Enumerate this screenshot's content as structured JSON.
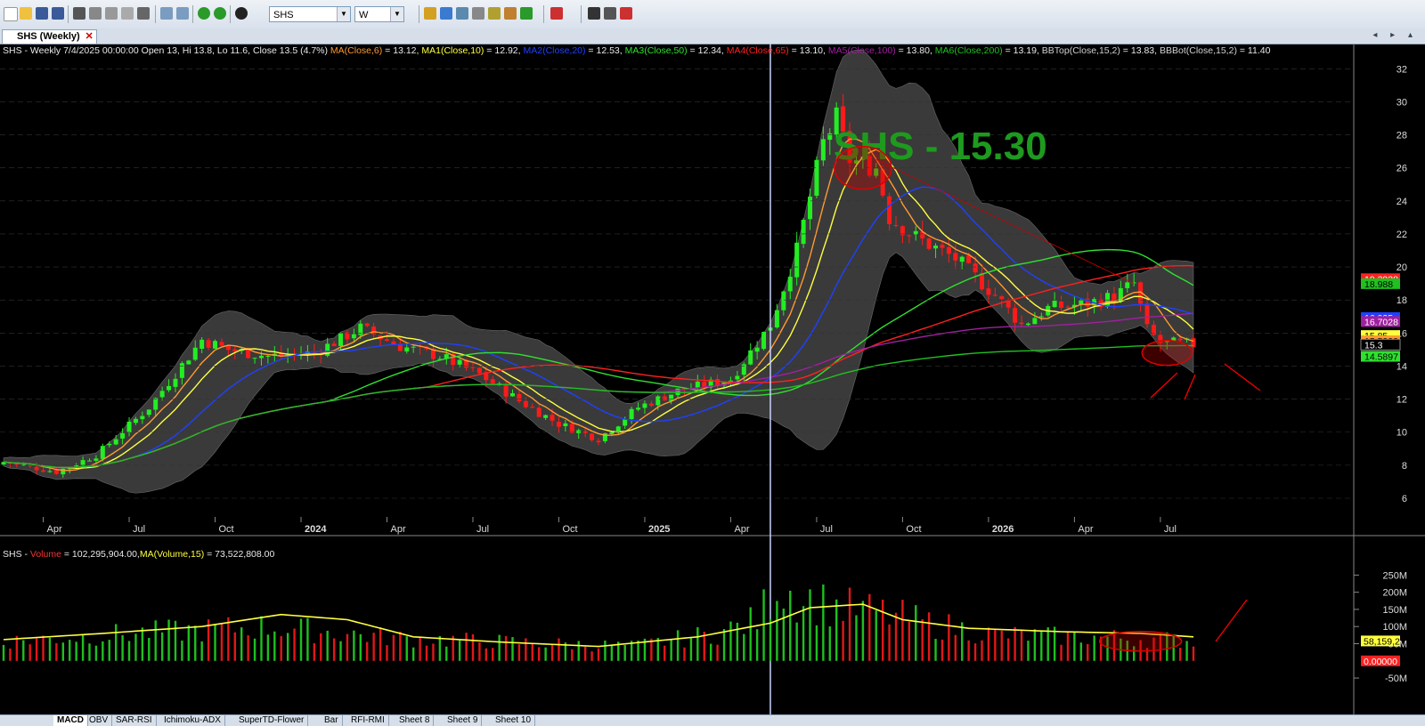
{
  "toolbar": {
    "symbol": "SHS",
    "interval": "W",
    "colors": {
      "new": "#ffffff",
      "open": "#f0c040",
      "save": "#3a5a9a",
      "print": "#555555",
      "back": "#2a9a2a",
      "forward": "#2a9a2a",
      "info": "#222222",
      "draw": "#cc3030"
    }
  },
  "window_tab": {
    "title": "SHS (Weekly)",
    "close": "✕"
  },
  "price_header": {
    "symbol_line": "SHS - Weekly 7/4/2025 00:00:00 Open 13, Hi 13.8, Lo 11.6, Close 13.5 (4.7%)",
    "indicators": [
      {
        "label": "MA(Close,6)",
        "value": " = 13.12,",
        "color": "#ff9a30"
      },
      {
        "label": "MA1(Close,10)",
        "value": " = 12.92,",
        "color": "#ffff40"
      },
      {
        "label": "MA2(Close,20)",
        "value": " = 12.53,",
        "color": "#2040ff"
      },
      {
        "label": "MA3(Close,50)",
        "value": " = 12.34,",
        "color": "#30e030"
      },
      {
        "label": "MA4(Close,65)",
        "value": " = 13.10,",
        "color": "#ff2020"
      },
      {
        "label": "MA5(Close,100)",
        "value": " = 13.80,",
        "color": "#a020a0"
      },
      {
        "label": "MA6(Close,200)",
        "value": " = 13.19,",
        "color": "#20c020"
      },
      {
        "label": "BBTop(Close,15,2)",
        "value": " = 13.83,",
        "color": "#d0d0d0"
      },
      {
        "label": "BBBot(Close,15,2)",
        "value": " = 11.40",
        "color": "#d0d0d0"
      }
    ]
  },
  "volume_header": {
    "prefix": "SHS - ",
    "volume_label": "Volume",
    "volume_value": " = 102,295,904.00,",
    "ma_label": "MA(Volume,15)",
    "ma_value": " = 73,522,808.00"
  },
  "chart_data": {
    "type": "candlestick",
    "title": "SHS (Weekly)",
    "overlay_text": "SHS - 15.30",
    "price_axis": {
      "ticks": [
        6,
        8,
        10,
        12,
        14,
        16,
        18,
        20,
        22,
        24,
        26,
        28,
        30,
        32
      ],
      "ylim": [
        4.6,
        33.2
      ]
    },
    "time_axis": {
      "labels": [
        "Apr",
        "Jul",
        "Oct",
        "2024",
        "Apr",
        "Jul",
        "Oct",
        "2025",
        "Apr",
        "Jul",
        "Oct",
        "2026",
        "Apr",
        "Jul"
      ],
      "bold": [
        "2024",
        "2025",
        "2026"
      ]
    },
    "price_key_points": [
      [
        0,
        8.2
      ],
      [
        8,
        7.6
      ],
      [
        14,
        8.6
      ],
      [
        22,
        11.5
      ],
      [
        30,
        15.6
      ],
      [
        34,
        15.0
      ],
      [
        40,
        14.6
      ],
      [
        47,
        14.8
      ],
      [
        54,
        16.3
      ],
      [
        60,
        15.2
      ],
      [
        66,
        14.6
      ],
      [
        72,
        13.5
      ],
      [
        78,
        11.9
      ],
      [
        84,
        10.5
      ],
      [
        90,
        9.6
      ],
      [
        96,
        11.5
      ],
      [
        102,
        12.5
      ],
      [
        110,
        13.2
      ],
      [
        116,
        16.5
      ],
      [
        120,
        21.0
      ],
      [
        124,
        27.5
      ],
      [
        126,
        29.0
      ],
      [
        128,
        26.5
      ],
      [
        132,
        26.0
      ],
      [
        134,
        23.0
      ],
      [
        138,
        21.8
      ],
      [
        144,
        20.5
      ],
      [
        150,
        18.3
      ],
      [
        154,
        16.5
      ],
      [
        158,
        17.5
      ],
      [
        164,
        17.8
      ],
      [
        168,
        18.2
      ],
      [
        171,
        19.0
      ],
      [
        173,
        16.2
      ],
      [
        175,
        15.4
      ],
      [
        180,
        15.3
      ]
    ],
    "moving_average_series": [
      {
        "name": "MA(Close,6)",
        "color": "#ff9a30",
        "period": 6
      },
      {
        "name": "MA1(Close,10)",
        "color": "#ffff40",
        "period": 10
      },
      {
        "name": "MA2(Close,20)",
        "color": "#2040ff",
        "period": 20
      },
      {
        "name": "MA3(Close,50)",
        "color": "#30e030",
        "period": 50
      },
      {
        "name": "MA4(Close,65)",
        "color": "#ff2020",
        "period": 65
      },
      {
        "name": "MA5(Close,100)",
        "color": "#a020a0",
        "period": 100
      },
      {
        "name": "MA6(Close,200)",
        "color": "#20c020",
        "period": 200
      }
    ],
    "bollinger": {
      "period": 15,
      "k": 2,
      "fill": "#3a3a3a"
    },
    "right_price_labels": [
      {
        "text": "19.2938",
        "value": 19.29,
        "bg": "#ff2020",
        "fg": "#ffffff"
      },
      {
        "text": "18.988",
        "value": 18.99,
        "bg": "#20c020",
        "fg": "#000000"
      },
      {
        "text": "16.935",
        "value": 16.94,
        "bg": "#2040ff",
        "fg": "#ffffff"
      },
      {
        "text": "16.7028",
        "value": 16.7,
        "bg": "#a020a0",
        "fg": "#ffffff"
      },
      {
        "text": "15.85",
        "value": 15.85,
        "bg": "#ffff40",
        "fg": "#000000"
      },
      {
        "text": "15.5333",
        "value": 15.53,
        "bg": "#ff9a30",
        "fg": "#000000"
      },
      {
        "text": "15.3",
        "value": 15.3,
        "bg": "#000000",
        "fg": "#ffffff"
      },
      {
        "text": "14.5897",
        "value": 14.59,
        "bg": "#30e030",
        "fg": "#000000"
      }
    ],
    "volume_axis": {
      "tick_labels": [
        "250M",
        "200M",
        "150M",
        "100M",
        "50M",
        "-50M"
      ],
      "tick_values": [
        250,
        200,
        150,
        100,
        50,
        -50
      ],
      "ylim": [
        -55,
        295
      ],
      "unit": "millions"
    },
    "volume_key_points": [
      [
        0,
        60
      ],
      [
        20,
        85
      ],
      [
        40,
        105
      ],
      [
        60,
        70
      ],
      [
        80,
        55
      ],
      [
        95,
        45
      ],
      [
        108,
        85
      ],
      [
        114,
        125
      ],
      [
        117,
        240
      ],
      [
        120,
        200
      ],
      [
        126,
        165
      ],
      [
        132,
        150
      ],
      [
        140,
        115
      ],
      [
        150,
        80
      ],
      [
        160,
        75
      ],
      [
        170,
        70
      ],
      [
        180,
        62
      ]
    ],
    "volume_ma_points": [
      [
        0,
        62
      ],
      [
        15,
        80
      ],
      [
        30,
        100
      ],
      [
        42,
        135
      ],
      [
        52,
        120
      ],
      [
        62,
        70
      ],
      [
        75,
        55
      ],
      [
        90,
        42
      ],
      [
        105,
        70
      ],
      [
        116,
        110
      ],
      [
        122,
        155
      ],
      [
        130,
        165
      ],
      [
        136,
        120
      ],
      [
        146,
        95
      ],
      [
        160,
        85
      ],
      [
        172,
        80
      ],
      [
        180,
        70
      ]
    ],
    "volume_right_labels": [
      {
        "text": "58,159,2",
        "value": 58,
        "bg": "#ffff40",
        "fg": "#000000"
      },
      {
        "text": "0.00000",
        "value": 0,
        "bg": "#ff2020",
        "fg": "#ffffff"
      }
    ],
    "cursor_week": 116
  },
  "sheet_tabs": [
    "MACD",
    "OBV",
    "SAR-RSI",
    "Ichimoku-ADX",
    "SuperTD-Flower",
    "Bar",
    "RFI-RMI",
    "Sheet 8",
    "Sheet 9",
    "Sheet 10"
  ],
  "nav_arrows": "◂ ▸ ▴"
}
